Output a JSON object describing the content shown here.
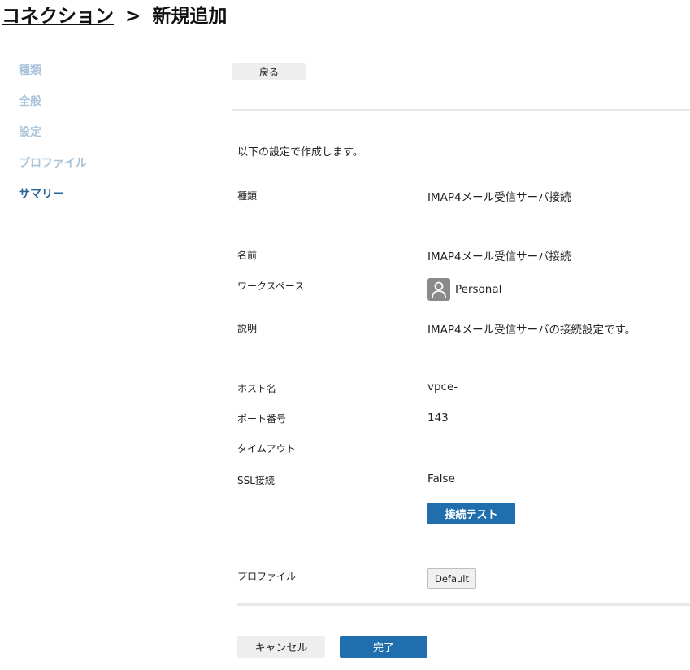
{
  "breadcrumb": {
    "parent": "コネクション",
    "separator": ">",
    "current": "新規追加"
  },
  "steps": [
    {
      "label": "種類",
      "active": false
    },
    {
      "label": "全般",
      "active": false
    },
    {
      "label": "設定",
      "active": false
    },
    {
      "label": "プロファイル",
      "active": false
    },
    {
      "label": "サマリー",
      "active": true
    }
  ],
  "back_label": "戻る",
  "intro_text": "以下の設定で作成します。",
  "summary": {
    "type": {
      "label": "種類",
      "value": "IMAP4メール受信サーバ接続"
    },
    "name": {
      "label": "名前",
      "value": "IMAP4メール受信サーバ接続"
    },
    "workspace": {
      "label": "ワークスペース",
      "value": "Personal",
      "icon": "user-icon"
    },
    "description": {
      "label": "説明",
      "value": "IMAP4メール受信サーバの接続設定です。"
    },
    "host": {
      "label": "ホスト名",
      "value": "vpce-"
    },
    "port": {
      "label": "ポート番号",
      "value": "143"
    },
    "timeout": {
      "label": "タイムアウト",
      "value": ""
    },
    "ssl": {
      "label": "SSL接続",
      "value": "False"
    },
    "profile": {
      "label": "プロファイル",
      "value": "Default"
    }
  },
  "test_button_label": "接続テスト",
  "cancel_label": "キャンセル",
  "finish_label": "完了",
  "colors": {
    "primary": "#1f6fae",
    "step_active": "#2a6496",
    "step_inactive": "#a9c4da"
  }
}
